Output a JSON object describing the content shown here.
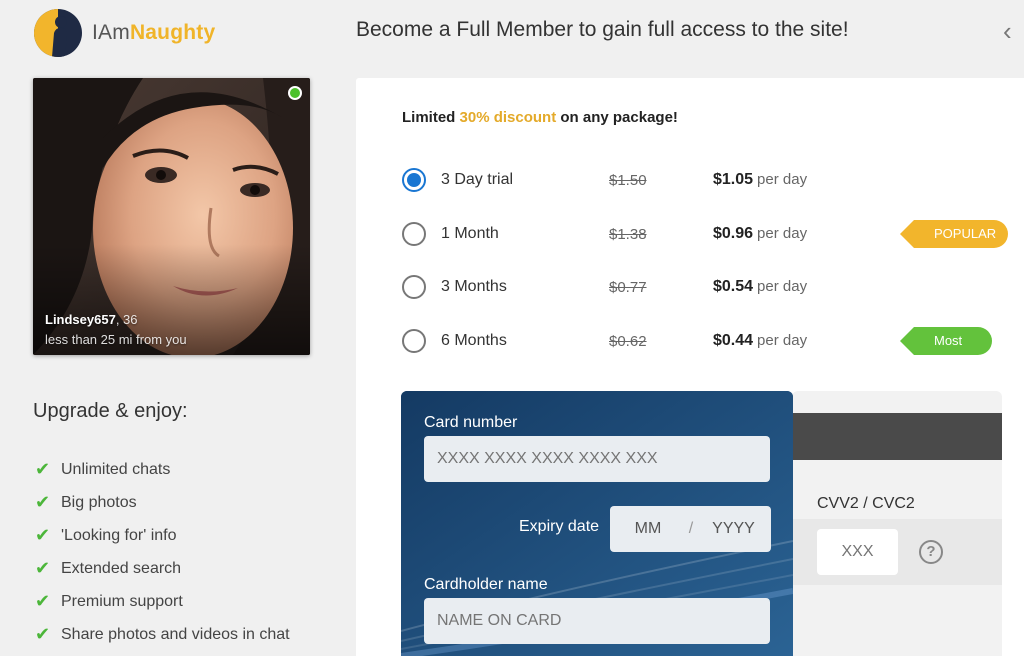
{
  "brand": {
    "name_plain": "IAm",
    "name_accent": "Naughty"
  },
  "header": {
    "title": "Become a Full Member to gain full access to the site!",
    "back_icon": "chevron-left-icon"
  },
  "profile": {
    "name": "Lindsey657",
    "age": ", 36",
    "distance": "less than 25 mi from you",
    "online": true
  },
  "upgrade": {
    "title": "Upgrade & enjoy:",
    "benefits": [
      "Unlimited chats",
      "Big photos",
      "'Looking for' info",
      "Extended search",
      "Premium support",
      "Share photos and videos in chat"
    ]
  },
  "offer": {
    "prefix": "Limited ",
    "highlight": "30% discount",
    "suffix": " on any package!"
  },
  "plans": [
    {
      "name": "3 Day trial",
      "old_price": "$1.50",
      "new_price": "$1.05",
      "unit": "per day",
      "selected": true,
      "tag": ""
    },
    {
      "name": "1 Month",
      "old_price": "$1.38",
      "new_price": "$0.96",
      "unit": "per day",
      "selected": false,
      "tag": "POPULAR"
    },
    {
      "name": "3 Months",
      "old_price": "$0.77",
      "new_price": "$0.54",
      "unit": "per day",
      "selected": false,
      "tag": ""
    },
    {
      "name": "6 Months",
      "old_price": "$0.62",
      "new_price": "$0.44",
      "unit": "per day",
      "selected": false,
      "tag": "Most Savings"
    }
  ],
  "payment": {
    "card_number_label": "Card number",
    "card_number_placeholder": "XXXX XXXX XXXX XXXX XXX",
    "expiry_label": "Expiry date",
    "expiry_month": "MM",
    "expiry_separator": "/",
    "expiry_year": "YYYY",
    "holder_label": "Cardholder name",
    "holder_placeholder": "NAME ON CARD",
    "cvv_label": "CVV2 / CVC2",
    "cvv_placeholder": "XXX",
    "help_symbol": "?"
  },
  "colors": {
    "accent_yellow": "#f2b52c",
    "success_green": "#63c23c",
    "radio_blue": "#1976d2",
    "card_navy": "#1d4a74"
  }
}
